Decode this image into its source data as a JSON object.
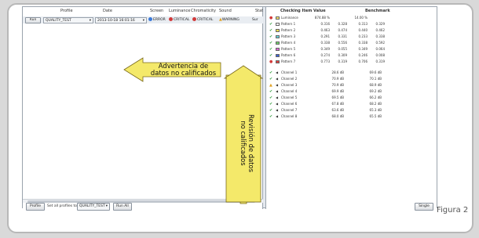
{
  "left_table": {
    "headers": [
      "Profile",
      "Date",
      "Screen",
      "Luminance",
      "Chromaticity",
      "Sound",
      "Stat"
    ],
    "row": {
      "run_label": "Run",
      "profile": "QUALITY_TEST",
      "date": "2013-10-18 16:01:16",
      "screen": "ERROR",
      "luminance": "CRITICAL",
      "chromaticity": "CRITICAL",
      "sound": "WARNING",
      "stat": "Sur"
    }
  },
  "right_table": {
    "headers": [
      "Checking Item",
      "Value",
      "Benchmark"
    ],
    "rows": [
      {
        "status": "error",
        "swatch": "#f4e06a",
        "label": "Luminance",
        "v1": "874.88 %",
        "v2": "",
        "b1": "14.00 %",
        "b2": ""
      },
      {
        "status": "ok",
        "swatch": "#f7f7f7",
        "label": "Pattern 1",
        "v1": "0.316",
        "v2": "0.328",
        "b1": "0.313",
        "b2": "0.329"
      },
      {
        "status": "ok",
        "swatch": "#f1e04a",
        "label": "Pattern 2",
        "v1": "0.463",
        "v2": "0.474",
        "b1": "0.440",
        "b2": "0.462"
      },
      {
        "status": "ok",
        "swatch": "#67d1d8",
        "label": "Pattern 3",
        "v1": "0.291",
        "v2": "0.331",
        "b1": "0.233",
        "b2": "0.338"
      },
      {
        "status": "ok",
        "swatch": "#6ed46a",
        "label": "Pattern 4",
        "v1": "0.338",
        "v2": "0.556",
        "b1": "0.338",
        "b2": "0.592"
      },
      {
        "status": "ok",
        "swatch": "#d86bd0",
        "label": "Pattern 5",
        "v1": "0.349",
        "v2": "0.055",
        "b1": "0.349",
        "b2": "0.064"
      },
      {
        "status": "ok",
        "swatch": "#3c62d6",
        "label": "Pattern 6",
        "v1": "0.274",
        "v2": "0.309",
        "b1": "0.246",
        "b2": "0.008"
      },
      {
        "status": "error",
        "swatch": "#e04040",
        "label": "Pattern 7",
        "v1": "0.773",
        "v2": "0.319",
        "b1": "0.706",
        "b2": "0.319"
      }
    ],
    "channels": [
      {
        "status": "ok",
        "label": "Channel 1",
        "v1": "28.6 dB",
        "b1": "69.6 dB"
      },
      {
        "status": "ok",
        "label": "Channel 2",
        "v1": "70.9 dB",
        "b1": "70.1 dB"
      },
      {
        "status": "warn",
        "label": "Channel 3",
        "v1": "70.9 dB",
        "b1": "68.9 dB"
      },
      {
        "status": "ok",
        "label": "Channel 4",
        "v1": "69.9 dB",
        "b1": "69.2 dB"
      },
      {
        "status": "ok",
        "label": "Channel 5",
        "v1": "69.5 dB",
        "b1": "66.2 dB"
      },
      {
        "status": "ok",
        "label": "Channel 6",
        "v1": "67.8 dB",
        "b1": "68.2 dB"
      },
      {
        "status": "ok",
        "label": "Channel 7",
        "v1": "63.6 dB",
        "b1": "65.3 dB"
      },
      {
        "status": "ok",
        "label": "Channel 8",
        "v1": "68.0 dB",
        "b1": "65.5 dB"
      }
    ]
  },
  "bottom_bar": {
    "profile_button": "Profile",
    "set_label": "Set all profiles to",
    "profile_select": "QUALITY_TEST",
    "run_all_button": "Run All",
    "single_button": "Single"
  },
  "callouts": {
    "left_line1": "Advertencia de",
    "left_line2": "datos no calificados",
    "right_line1": "Revisión de datos",
    "right_line2": "no calificados"
  },
  "figure_label": "Figura 2",
  "colors": {
    "callout_fill": "#f4e96a",
    "callout_stroke": "#7a6a1a",
    "critical": "#d23a3a",
    "ok": "#2f9a3a",
    "warning": "#e0a020"
  }
}
